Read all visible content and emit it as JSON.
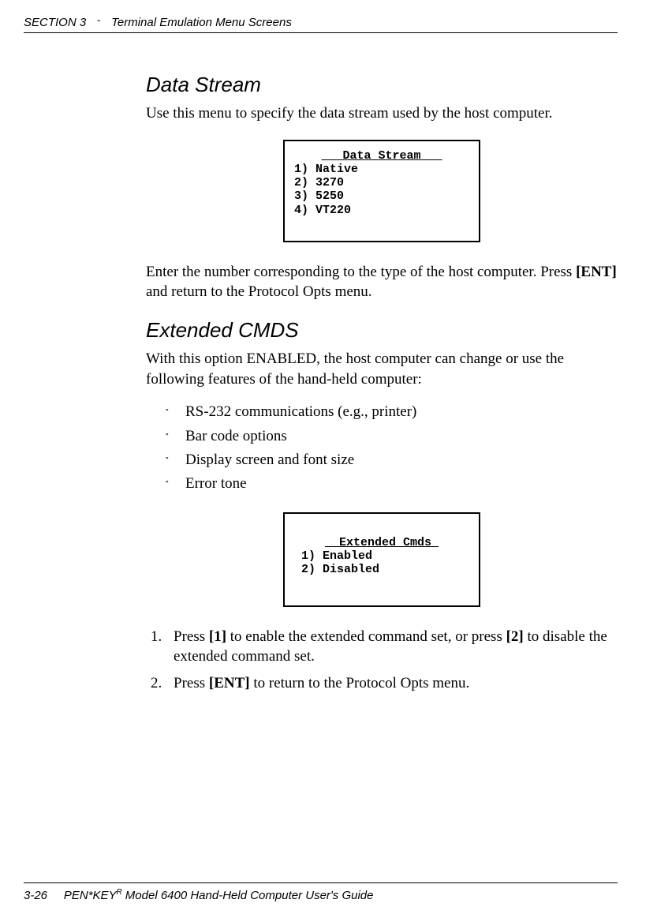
{
  "header": {
    "section": "SECTION 3",
    "bullet": "\"",
    "title": "Terminal Emulation Menu Screens"
  },
  "section1": {
    "heading": "Data Stream",
    "intro": "Use this menu to specify the data stream used by the host computer.",
    "terminal": {
      "title": "   Data Stream   ",
      "line1": "1) Native",
      "line2": "2) 3270",
      "line3": "3) 5250",
      "line4": "4) VT220"
    },
    "outro_a": "Enter the number corresponding to the type of the host computer.  Press ",
    "outro_key": "[ENT]",
    "outro_b": " and return to the Protocol Opts menu."
  },
  "section2": {
    "heading": "Extended CMDS",
    "intro": "With this option ENABLED, the host computer can change or use the following features of the hand-held computer:",
    "bullet1": "RS-232 communications (e.g., printer)",
    "bullet2": "Bar code options",
    "bullet3": "Display screen and font size",
    "bullet4": "Error tone",
    "terminal": {
      "title": "  Extended Cmds ",
      "line1": " 1) Enabled",
      "line2": " 2) Disabled"
    },
    "step1_a": "Press ",
    "step1_key1": "[1]",
    "step1_b": " to enable the extended command set, or press ",
    "step1_key2": "[2]",
    "step1_c": " to disable the extended command set.",
    "step2_a": "Press ",
    "step2_key": "[ENT]",
    "step2_b": " to return to the Protocol Opts menu."
  },
  "footer": {
    "page": "3-26",
    "brand_a": "PEN*KEY",
    "brand_sup": "R",
    "rest": " Model 6400 Hand-Held Computer User's Guide"
  }
}
